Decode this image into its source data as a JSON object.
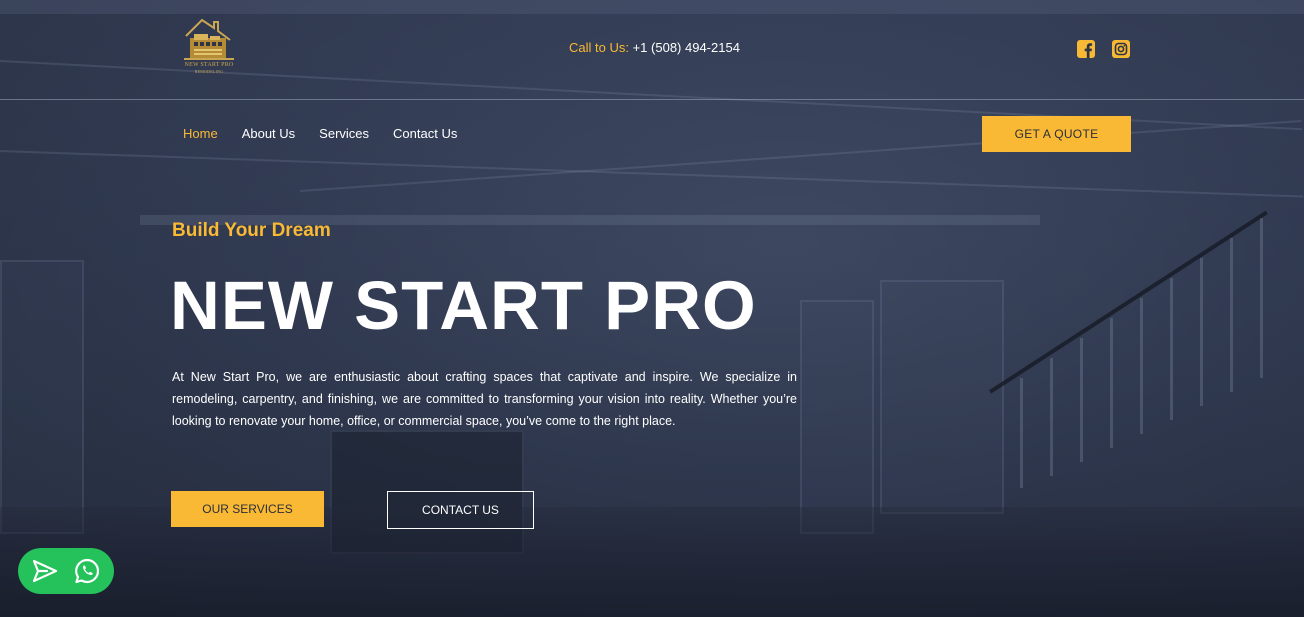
{
  "brand": {
    "logo_text_line1": "NEW START PRO",
    "logo_text_line2": "REMODELING",
    "accent_color": "#f9b934"
  },
  "topbar": {
    "call_label": "Call to Us:",
    "phone": "+1 (508) 494-2154",
    "social": [
      {
        "icon": "facebook-icon"
      },
      {
        "icon": "instagram-icon"
      }
    ]
  },
  "nav": {
    "items": [
      {
        "label": "Home",
        "active": true
      },
      {
        "label": "About Us",
        "active": false
      },
      {
        "label": "Services",
        "active": false
      },
      {
        "label": "Contact Us",
        "active": false
      }
    ],
    "cta_label": "GET A QUOTE"
  },
  "hero": {
    "eyebrow": "Build Your Dream",
    "headline": "NEW START PRO",
    "intro": "At New Start Pro, we are enthusiastic about crafting spaces that captivate and inspire. We specialize in remodeling, carpentry, and finishing, we are committed to transforming your vision into reality. Whether you’re looking to renovate your home, office, or commercial space, you’ve come to the right place.",
    "primary_button": "OUR SERVICES",
    "secondary_button": "CONTACT US"
  },
  "chat_widget": {
    "icons": [
      "send-icon",
      "whatsapp-icon"
    ],
    "color": "#25c15a"
  }
}
